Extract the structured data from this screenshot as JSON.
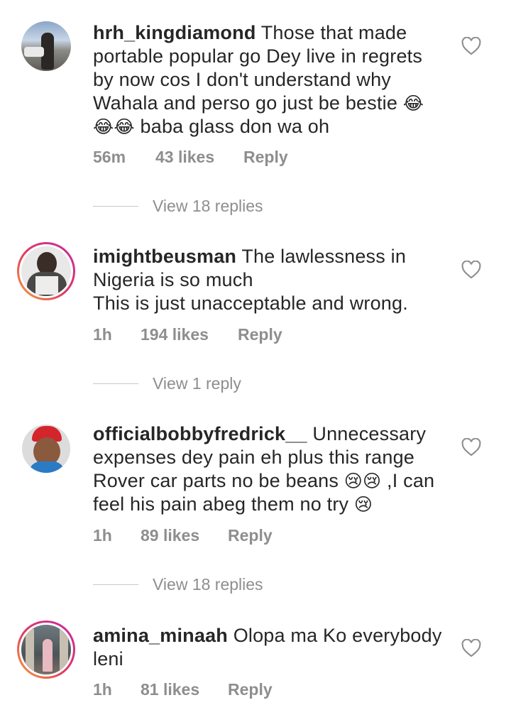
{
  "comments": [
    {
      "username": "hrh_kingdiamond",
      "text": "Those that made portable popular go Dey live in regrets by now cos I don't understand why Wahala and perso go just be bestie",
      "text_tail": "baba glass don wa oh",
      "emoji_a": "😂",
      "emoji_b": "😂😂",
      "time": "56m",
      "likes": "43 likes",
      "reply": "Reply",
      "view_replies": "View 18 replies",
      "ring": false
    },
    {
      "username": "imightbeusman",
      "text_line1": "The lawlessness in Nigeria is so much",
      "text_line2": "This is just unacceptable and wrong.",
      "time": "1h",
      "likes": "194 likes",
      "reply": "Reply",
      "view_replies": "View 1 reply",
      "ring": true
    },
    {
      "username": "officialbobbyfredrick__",
      "text": "Unnecessary expenses dey pain eh plus this range Rover car parts no be beans",
      "emoji_a": "😢😢",
      "text_mid": ",I can feel his pain abeg them no try",
      "emoji_b": "😢",
      "time": "1h",
      "likes": "89 likes",
      "reply": "Reply",
      "view_replies": "View 18 replies",
      "ring": false
    },
    {
      "username": "amina_minaah",
      "text": "Olopa ma Ko everybody leni",
      "time": "1h",
      "likes": "81 likes",
      "reply": "Reply",
      "ring": true
    }
  ],
  "icons": {
    "like": "heart-outline-icon"
  },
  "colors": {
    "text": "#262626",
    "meta": "#8e8e8e",
    "ring_start": "#f9a23a",
    "ring_end": "#c32aa3"
  }
}
